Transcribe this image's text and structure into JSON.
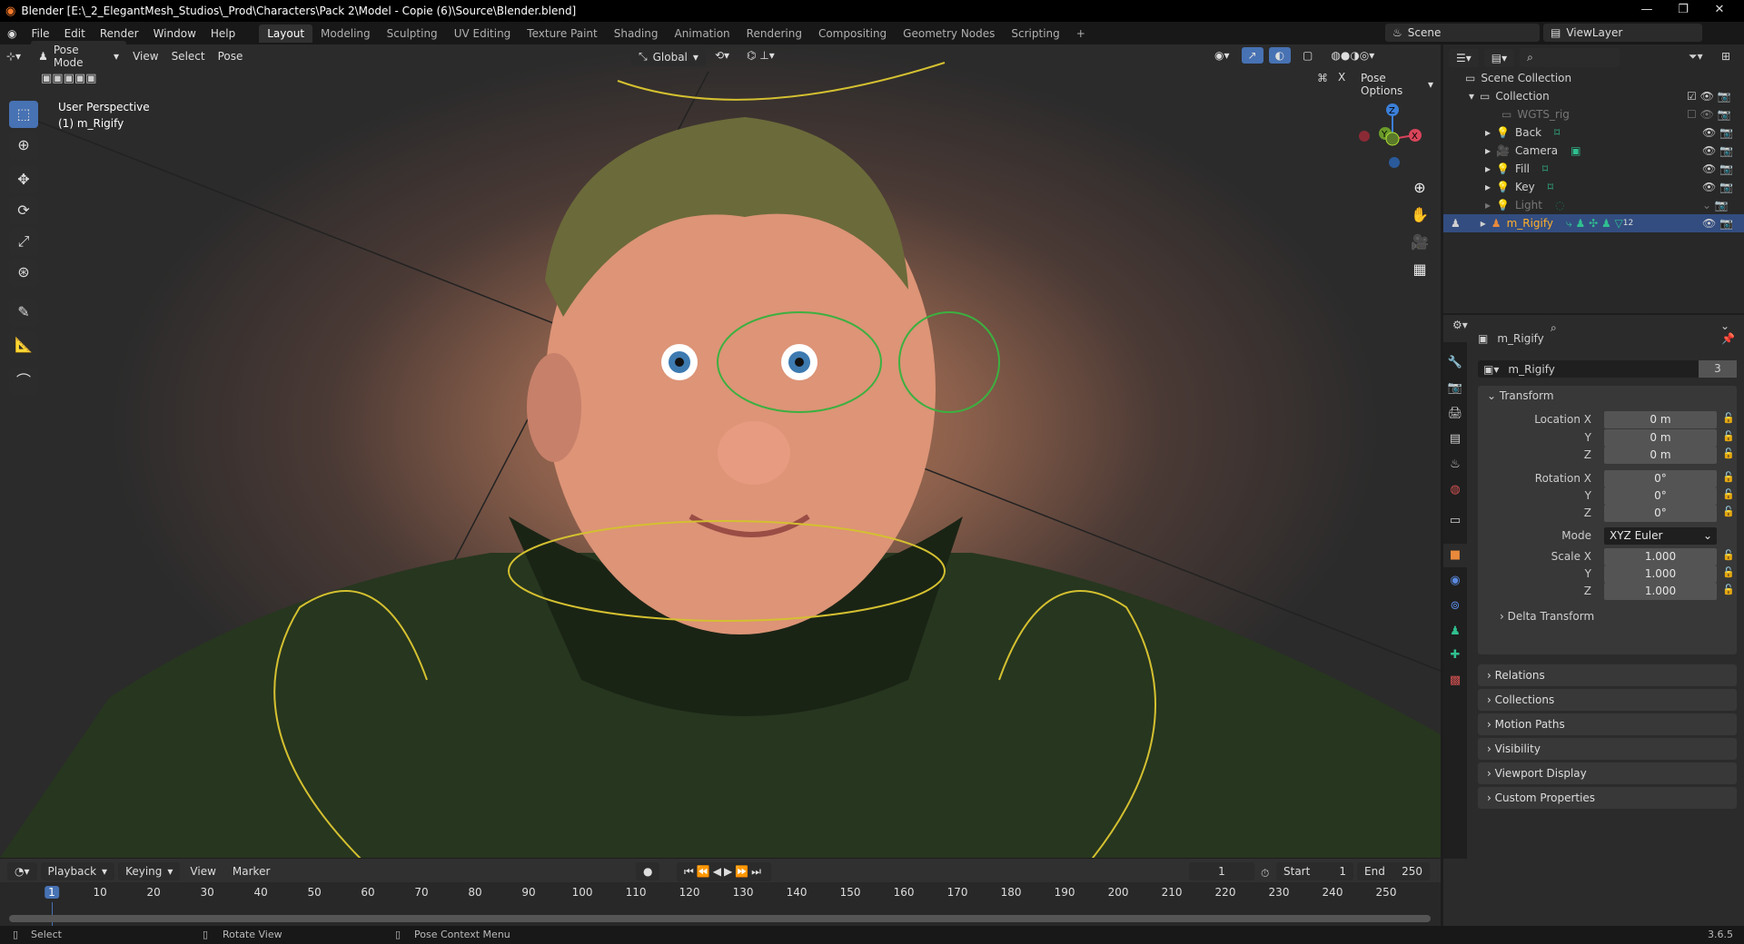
{
  "title": "Blender [E:\\_2_ElegantMesh_Studios\\_Prod\\Characters\\Pack 2\\Model - Copie (6)\\Source\\Blender.blend]",
  "menus": [
    "File",
    "Edit",
    "Render",
    "Window",
    "Help"
  ],
  "workspaces": [
    "Layout",
    "Modeling",
    "Sculpting",
    "UV Editing",
    "Texture Paint",
    "Shading",
    "Animation",
    "Rendering",
    "Compositing",
    "Geometry Nodes",
    "Scripting",
    "+"
  ],
  "scene": "Scene",
  "view_layer": "ViewLayer",
  "vheader": {
    "mode": "Pose Mode",
    "items": [
      "View",
      "Select",
      "Pose"
    ],
    "orientation": "Global",
    "pose_options": "Pose Options",
    "x_mirror": "X"
  },
  "viewport": {
    "perspective": "User Perspective",
    "object": "(1) m_Rigify",
    "gizmo": {
      "z": "Z",
      "y": "Y",
      "x": "X"
    }
  },
  "outliner": {
    "root": "Scene Collection",
    "items": [
      {
        "name": "Collection",
        "level": 0
      },
      {
        "name": "WGTS_rig",
        "level": 1
      },
      {
        "name": "Back",
        "level": 1
      },
      {
        "name": "Camera",
        "level": 1
      },
      {
        "name": "Fill",
        "level": 1
      },
      {
        "name": "Key",
        "level": 1
      },
      {
        "name": "Light",
        "level": 1
      },
      {
        "name": "m_Rigify",
        "level": 1,
        "selected": true
      }
    ],
    "rig_badge": "12"
  },
  "properties": {
    "object_name": "m_Rigify",
    "data_name": "m_Rigify",
    "users": "3",
    "transform_label": "Transform",
    "location": {
      "label": "Location X",
      "x": "0 m",
      "y": "0 m",
      "z": "0 m"
    },
    "rotation": {
      "label": "Rotation X",
      "x": "0°",
      "y": "0°",
      "z": "0°"
    },
    "mode_label": "Mode",
    "mode": "XYZ Euler",
    "scale": {
      "label": "Scale X",
      "x": "1.000",
      "y": "1.000",
      "z": "1.000"
    },
    "axis": {
      "y": "Y",
      "z": "Z"
    },
    "delta": "Delta Transform",
    "panels": [
      "Relations",
      "Collections",
      "Motion Paths",
      "Visibility",
      "Viewport Display",
      "Custom Properties"
    ]
  },
  "timeline": {
    "menus": [
      "Playback",
      "Keying",
      "View",
      "Marker"
    ],
    "current_frame": "1",
    "start_label": "Start",
    "start": "1",
    "end_label": "End",
    "end": "250",
    "frames": [
      "1",
      "10",
      "20",
      "30",
      "40",
      "50",
      "60",
      "70",
      "80",
      "90",
      "100",
      "110",
      "120",
      "130",
      "140",
      "150",
      "160",
      "170",
      "180",
      "190",
      "200",
      "210",
      "220",
      "230",
      "240",
      "250"
    ]
  },
  "status": {
    "select": "Select",
    "rotate": "Rotate View",
    "context": "Pose Context Menu",
    "version": "3.6.5"
  },
  "colors": {
    "accent": "#4772b3",
    "selected_text": "#ffaf29",
    "object_orange": "#e8893b",
    "data_green": "#30c090"
  }
}
